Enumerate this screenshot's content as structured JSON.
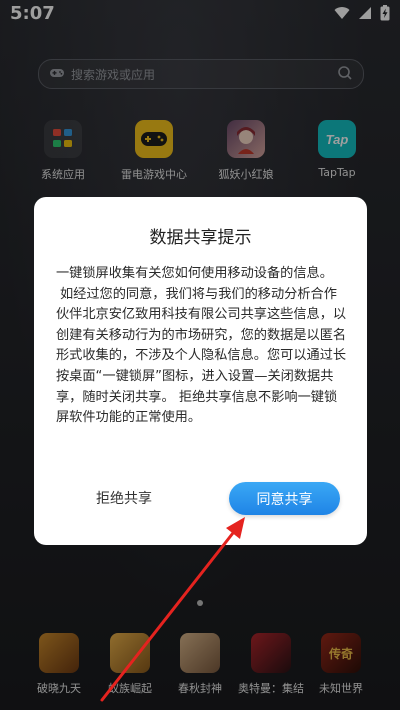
{
  "status_bar": {
    "time": "5:07",
    "icons": [
      "wifi-icon",
      "signal-icon",
      "battery-charging-icon"
    ]
  },
  "search": {
    "placeholder": "搜索游戏或应用"
  },
  "home_apps": [
    {
      "label": "系统应用",
      "icon": "folder-grid-icon"
    },
    {
      "label": "雷电游戏中心",
      "icon": "gamepad-icon"
    },
    {
      "label": "狐妖小红娘",
      "icon": "game-avatar-icon"
    },
    {
      "label": "TapTap",
      "icon": "taptap-icon",
      "icon_text": "Tap"
    }
  ],
  "dock_apps": [
    {
      "label": "破晓九天"
    },
    {
      "label": "蚁族崛起"
    },
    {
      "label": "春秋封神"
    },
    {
      "label": "奥特曼：集结"
    },
    {
      "label": "未知世界",
      "icon_text": "传奇"
    }
  ],
  "dialog": {
    "title": "数据共享提示",
    "paragraphs": [
      "一键锁屏收集有关您如何使用移动设备的信息。",
      "如经过您的同意，我们将与我们的移动分析合作伙伴北京安亿致用科技有限公司共享这些信息，以创建有关移动行为的市场研究，您的数据是以匿名形式收集的，不涉及个人隐私信息。您可以通过长按桌面“一键锁屏”图标，进入设置—关闭数据共享，随时关闭共享。 拒绝共享信息不影响一键锁屏软件功能的正常使用。"
    ],
    "decline_label": "拒绝共享",
    "agree_label": "同意共享"
  },
  "colors": {
    "accent": "#2a8fe8",
    "annotation_arrow": "#e5231f",
    "background": "#202226"
  }
}
